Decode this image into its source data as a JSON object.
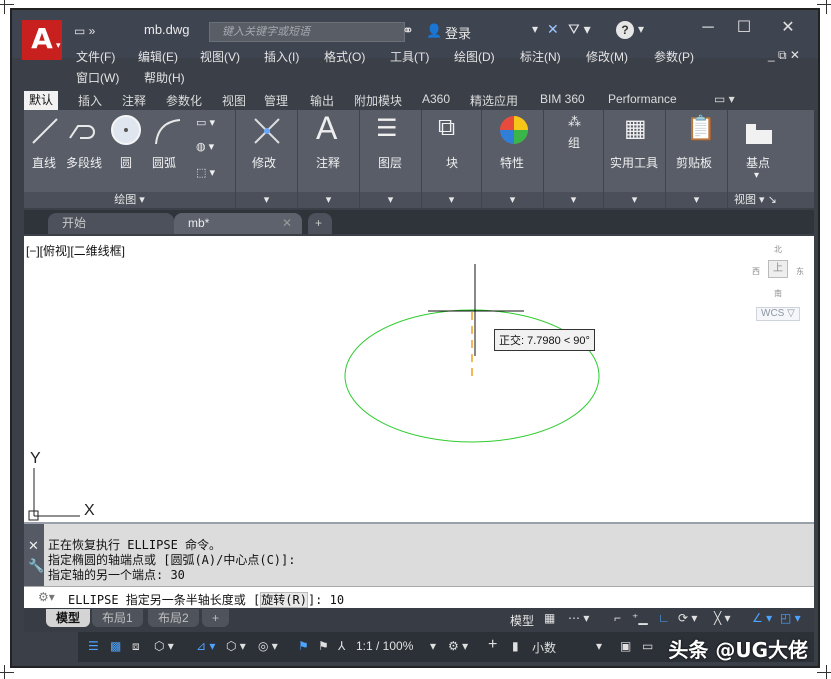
{
  "titlebar": {
    "logo_letter": "A",
    "doc_title": "mb.dwg",
    "search_placeholder": "键入关键字或短语",
    "login_label": "登录",
    "help_label": "?"
  },
  "menu": {
    "row1": [
      "文件(F)",
      "编辑(E)",
      "视图(V)",
      "插入(I)",
      "格式(O)",
      "工具(T)",
      "绘图(D)",
      "标注(N)",
      "修改(M)",
      "参数(P)"
    ],
    "row2": [
      "窗口(W)",
      "帮助(H)"
    ]
  },
  "ribbon_tabs": [
    "默认",
    "插入",
    "注释",
    "参数化",
    "视图",
    "管理",
    "输出",
    "附加模块",
    "A360",
    "精选应用",
    "BIM 360",
    "Performance"
  ],
  "ribbon": {
    "draw_tools": [
      "直线",
      "多段线",
      "圆",
      "圆弧"
    ],
    "draw_panel": "绘图 ▾",
    "panels": [
      "修改",
      "注释",
      "图层",
      "块",
      "特性",
      "组",
      "实用工具",
      "剪贴板",
      "基点"
    ],
    "view_panel": "视图 ▾"
  },
  "file_tabs": {
    "start": "开始",
    "current": "mb*",
    "new_tab": "+"
  },
  "canvas": {
    "view_label": "[−][俯视][二维线框]",
    "tooltip": "正交: 7.7980 < 90°",
    "viewcube": {
      "north": "北",
      "south": "南",
      "east": "东",
      "west": "西",
      "top": "上"
    },
    "wcs": "WCS ▽",
    "ucs_x": "X",
    "ucs_y": "Y"
  },
  "command": {
    "history": [
      "正在恢复执行 ELLIPSE 命令。",
      "指定椭圆的轴端点或 [圆弧(A)/中心点(C)]:",
      "指定轴的另一个端点: 30"
    ],
    "prompt_prefix": "ELLIPSE 指定另一条半轴长度或 [",
    "prompt_option": "旋转(R)",
    "prompt_suffix": "]: 10"
  },
  "layout_tabs": [
    "模型",
    "布局1",
    "布局2",
    "+"
  ],
  "status": {
    "model": "模型",
    "scale": "1:1 / 100%",
    "units": "小数"
  },
  "watermark": "头条 @UG大佬",
  "colors": {
    "accent_red": "#c81f1f",
    "ellipse_green": "#2ecc2e",
    "ortho_orange": "#f0a020"
  }
}
